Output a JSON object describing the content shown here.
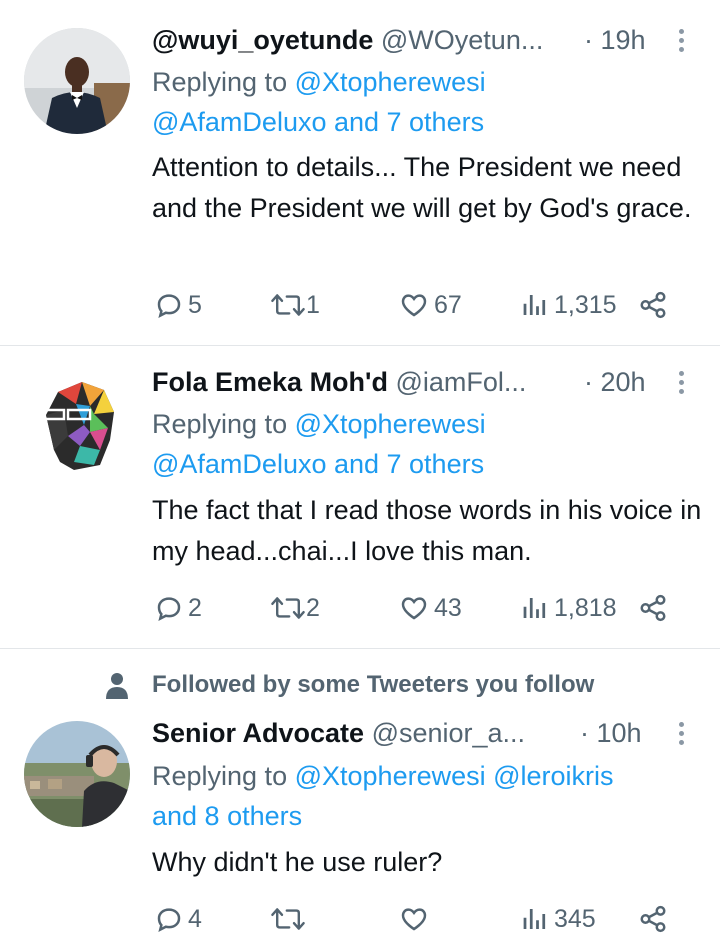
{
  "tweets": [
    {
      "name": "@wuyi_oyetunde",
      "handle": "@WOyetun...",
      "time": "· 19h",
      "replying_prefix": "Replying to",
      "replying_line1": "@Xtopherewesi",
      "replying_line2": "@AfamDeluxo and 7 others",
      "text": "Attention to details... The President we need and the President we will get by God's grace.",
      "replies": "5",
      "retweets": "1",
      "likes": "67",
      "views": "1,315"
    },
    {
      "name": "Fola Emeka Moh'd",
      "handle": "@iamFol...",
      "time": "· 20h",
      "replying_prefix": "Replying to",
      "replying_line1": "@Xtopherewesi",
      "replying_line2": "@AfamDeluxo and 7 others",
      "text": "The fact that I read those words in his voice in my head...chai...I love this man.",
      "replies": "2",
      "retweets": "2",
      "likes": "43",
      "views": "1,818"
    },
    {
      "social_context": "Followed by some Tweeters you follow",
      "name": "Senior Advocate",
      "handle": "@senior_a...",
      "time": "· 10h",
      "replying_prefix": "Replying to",
      "replying_line1": "@Xtopherewesi @leroikris",
      "replying_line2": "and 8 others",
      "text": "Why didn't he use ruler?",
      "replies": "4",
      "retweets": "",
      "likes": "",
      "views": "345"
    }
  ],
  "colors": {
    "link": "#1d9bf0",
    "muted": "#536471",
    "text": "#0f1419",
    "divider": "#e3e6e9"
  },
  "icons": [
    "more-icon",
    "reply-icon",
    "retweet-icon",
    "like-icon",
    "views-icon",
    "share-icon",
    "person-icon"
  ]
}
